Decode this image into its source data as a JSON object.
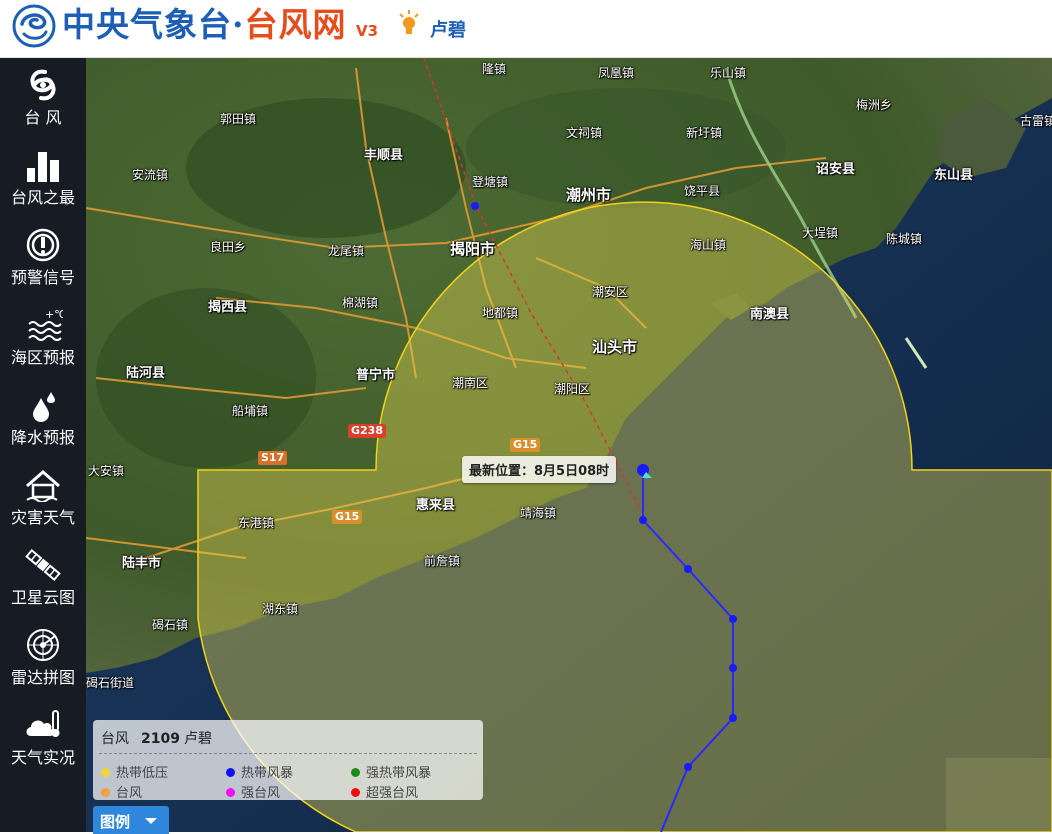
{
  "header": {
    "site_name_part1": "中央气象台·",
    "site_name_part2": "台风网",
    "version": "V3",
    "typhoon_name": "卢碧"
  },
  "sidebar": {
    "items": [
      {
        "label": "台 风",
        "icon": "typhoon-icon"
      },
      {
        "label": "台风之最",
        "icon": "bar-chart-icon"
      },
      {
        "label": "预警信号",
        "icon": "warning-signal-icon"
      },
      {
        "label": "海区预报",
        "icon": "sea-forecast-icon"
      },
      {
        "label": "降水预报",
        "icon": "rain-icon"
      },
      {
        "label": "灾害天气",
        "icon": "disaster-weather-icon"
      },
      {
        "label": "卫星云图",
        "icon": "satellite-icon"
      },
      {
        "label": "雷达拼图",
        "icon": "radar-icon"
      },
      {
        "label": "天气实况",
        "icon": "weather-live-icon"
      }
    ]
  },
  "map": {
    "places": [
      {
        "name": "隆镇"
      },
      {
        "name": "凤凰镇"
      },
      {
        "name": "乐山镇"
      },
      {
        "name": "梅洲乡"
      },
      {
        "name": "古雷镇"
      },
      {
        "name": "郭田镇"
      },
      {
        "name": "文祠镇"
      },
      {
        "name": "新圩镇"
      },
      {
        "name": "丰顺县"
      },
      {
        "name": "安流镇"
      },
      {
        "name": "登塘镇"
      },
      {
        "name": "潮州市"
      },
      {
        "name": "饶平县"
      },
      {
        "name": "诏安县"
      },
      {
        "name": "东山县"
      },
      {
        "name": "大埕镇"
      },
      {
        "name": "陈城镇"
      },
      {
        "name": "良田乡"
      },
      {
        "name": "龙尾镇"
      },
      {
        "name": "揭阳市"
      },
      {
        "name": "海山镇"
      },
      {
        "name": "揭西县"
      },
      {
        "name": "棉湖镇"
      },
      {
        "name": "潮安区"
      },
      {
        "name": "南澳县"
      },
      {
        "name": "地都镇"
      },
      {
        "name": "汕头市"
      },
      {
        "name": "陆河县"
      },
      {
        "name": "普宁市"
      },
      {
        "name": "潮南区"
      },
      {
        "name": "潮阳区"
      },
      {
        "name": "船埔镇"
      },
      {
        "name": "大安镇"
      },
      {
        "name": "惠来县"
      },
      {
        "name": "靖海镇"
      },
      {
        "name": "东港镇"
      },
      {
        "name": "前詹镇"
      },
      {
        "name": "陆丰市"
      },
      {
        "name": "湖东镇"
      },
      {
        "name": "碣石镇"
      },
      {
        "name": "碣石街道"
      }
    ],
    "roads": [
      "G238",
      "S17",
      "G15",
      "G15"
    ],
    "latest_position": "最新位置：8月5日08时",
    "track": {
      "description": "typhoon track points",
      "latest_point_color": "#1a1aff"
    }
  },
  "legend": {
    "title_label": "台风",
    "typhoon_id": "2109",
    "typhoon_name": "卢碧",
    "entries": [
      {
        "label": "热带低压",
        "color": "#f5d23a"
      },
      {
        "label": "热带风暴",
        "color": "#1010ee"
      },
      {
        "label": "强热带风暴",
        "color": "#1a8a1a"
      },
      {
        "label": "台风",
        "color": "#f0a040"
      },
      {
        "label": "强台风",
        "color": "#ee10ee"
      },
      {
        "label": "超强台风",
        "color": "#ee1010"
      }
    ],
    "toggle_label": "图例"
  }
}
